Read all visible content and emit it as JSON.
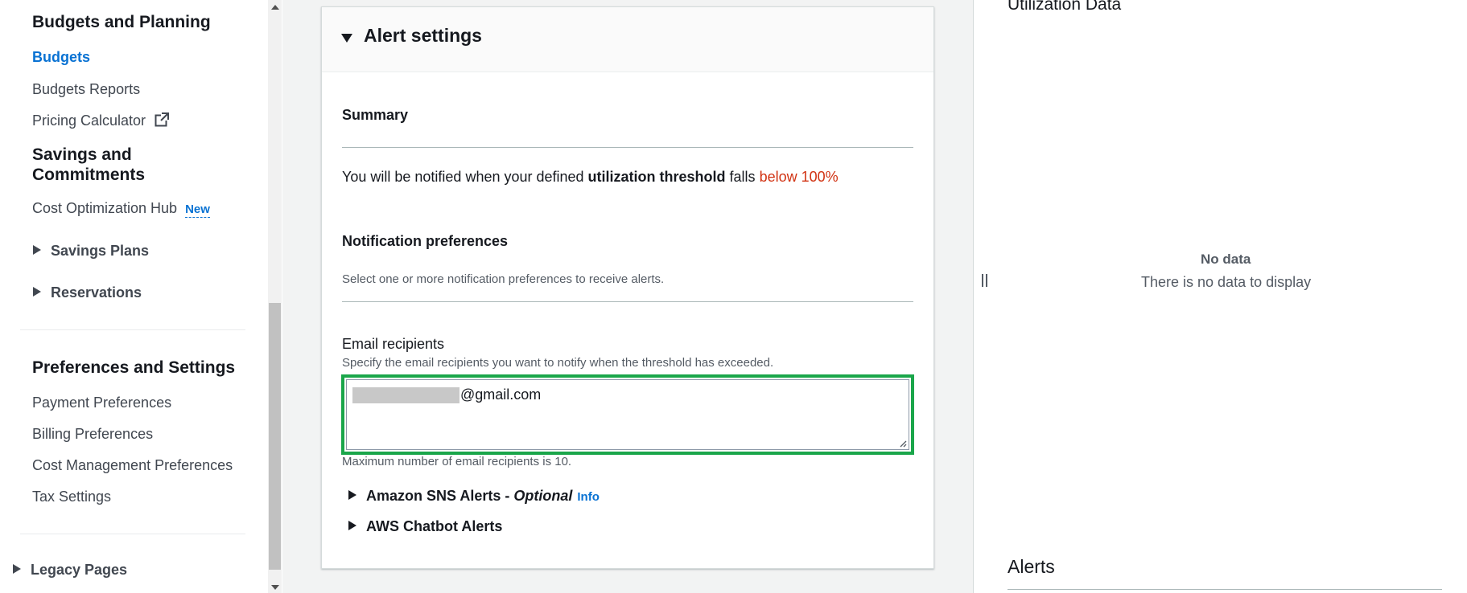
{
  "sidebar": {
    "budgets_heading": "Budgets and Planning",
    "budgets": "Budgets",
    "budgets_reports": "Budgets Reports",
    "pricing_calculator": "Pricing Calculator",
    "savings_heading_1": "Savings and",
    "savings_heading_2": "Commitments",
    "cost_optimization_hub": "Cost Optimization Hub",
    "new_badge": "New",
    "savings_plans": "Savings Plans",
    "reservations": "Reservations",
    "preferences_heading": "Preferences and Settings",
    "payment_preferences": "Payment Preferences",
    "billing_preferences": "Billing Preferences",
    "cost_management_preferences": "Cost Management Preferences",
    "tax_settings": "Tax Settings",
    "legacy_pages": "Legacy Pages"
  },
  "alert_settings": {
    "title": "Alert settings",
    "summary_title": "Summary",
    "summary_prefix": "You will be notified when your defined ",
    "summary_bold": "utilization threshold",
    "summary_middle": " falls ",
    "summary_red": "below 100%",
    "notification_title": "Notification preferences",
    "notification_desc": "Select one or more notification preferences to receive alerts.",
    "email_label": "Email recipients",
    "email_desc": "Specify the email recipients you want to notify when the threshold has exceeded.",
    "email_value_domain": "@gmail.com",
    "email_constraint": "Maximum number of email recipients is 10.",
    "sns_label": "Amazon SNS Alerts - ",
    "sns_optional": "Optional",
    "sns_info": "Info",
    "chatbot_label": "AWS Chatbot Alerts"
  },
  "right_panel": {
    "utilization_title": "Utilization Data",
    "no_data_title": "No data",
    "no_data_desc": "There is no data to display",
    "alerts_title": "Alerts"
  },
  "colors": {
    "link": "#0972d3",
    "warning": "#d13212",
    "highlight_border": "#1aa64a"
  }
}
